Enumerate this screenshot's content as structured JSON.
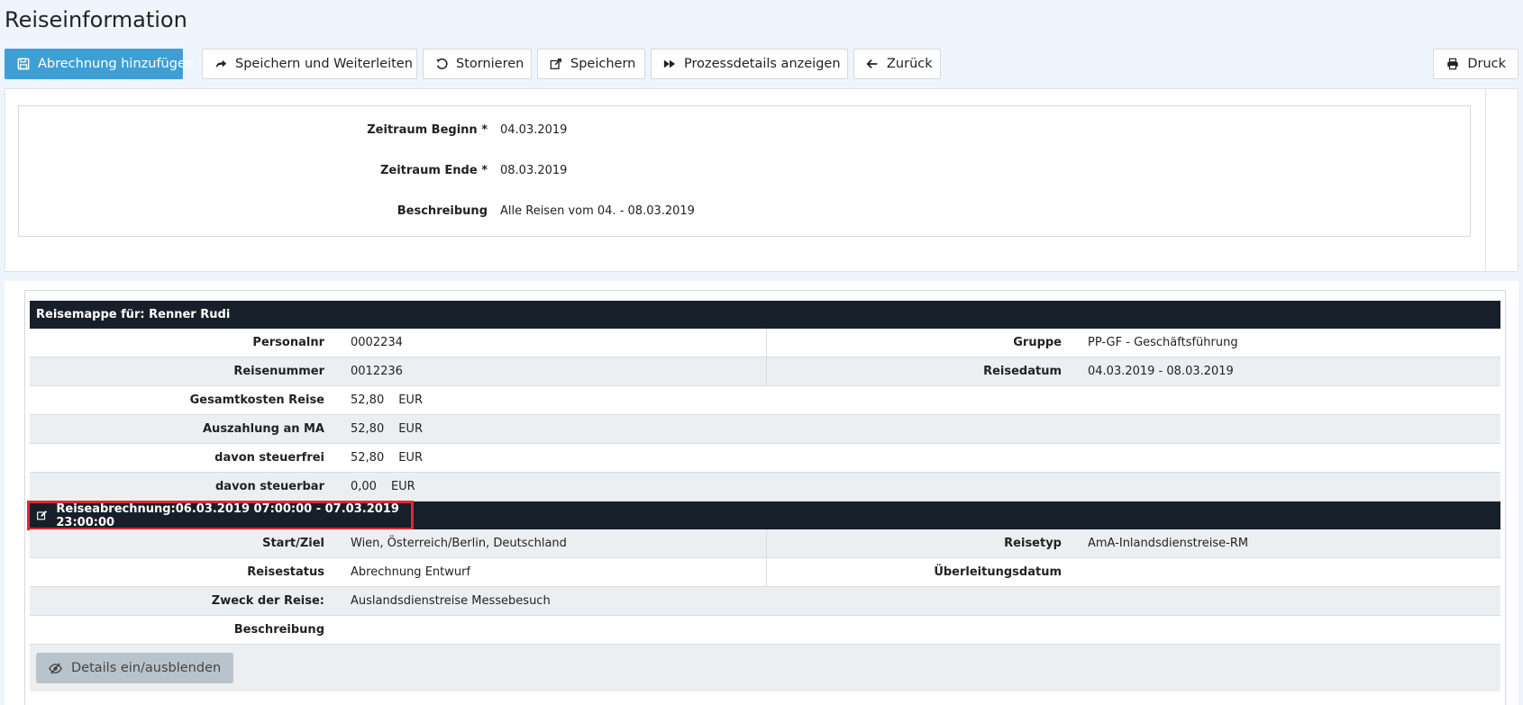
{
  "page": {
    "title": "Reiseinformation"
  },
  "toolbar": {
    "add_settlement": "Abrechnung hinzufügen",
    "save_forward": "Speichern und Weiterleiten",
    "cancel": "Stornieren",
    "save": "Speichern",
    "process_details": "Prozessdetails anzeigen",
    "back": "Zurück",
    "print": "Druck",
    "accent_color": "#3f9fd5"
  },
  "form": {
    "start_label": "Zeitraum Beginn *",
    "start_value": "04.03.2019",
    "end_label": "Zeitraum Ende *",
    "end_value": "08.03.2019",
    "desc_label": "Beschreibung",
    "desc_value": "Alle Reisen vom 04. - 08.03.2019"
  },
  "folder": {
    "header": "Reisemappe für: Renner Rudi",
    "personalnr_label": "Personalnr",
    "personalnr_value": "0002234",
    "gruppe_label": "Gruppe",
    "gruppe_value": "PP-GF - Geschäftsführung",
    "reisenummer_label": "Reisenummer",
    "reisenummer_value": "0012236",
    "reisedatum_label": "Reisedatum",
    "reisedatum_value": "04.03.2019 - 08.03.2019",
    "gesamtkosten_label": "Gesamtkosten Reise",
    "gesamtkosten_value": "52,80",
    "auszahlung_label": "Auszahlung an MA",
    "auszahlung_value": "52,80",
    "steuerfrei_label": "davon steuerfrei",
    "steuerfrei_value": "52,80",
    "steuerbar_label": "davon steuerbar",
    "steuerbar_value": "0,00",
    "currency": "EUR"
  },
  "settlement": {
    "header": "Reiseabrechnung:06.03.2019 07:00:00 - 07.03.2019 23:00:00",
    "highlight_color": "#e0282e",
    "startziel_label": "Start/Ziel",
    "startziel_value": "Wien, Österreich/Berlin, Deutschland",
    "reisetyp_label": "Reisetyp",
    "reisetyp_value": "AmA-Inlandsdienstreise-RM",
    "reisestatus_label": "Reisestatus",
    "reisestatus_value": "Abrechnung Entwurf",
    "ueberleitung_label": "Überleitungsdatum",
    "zweck_label": "Zweck der Reise:",
    "zweck_value": "Auslandsdienstreise Messebesuch",
    "beschreibung_label": "Beschreibung",
    "details_button": "Details ein/ausblenden"
  }
}
